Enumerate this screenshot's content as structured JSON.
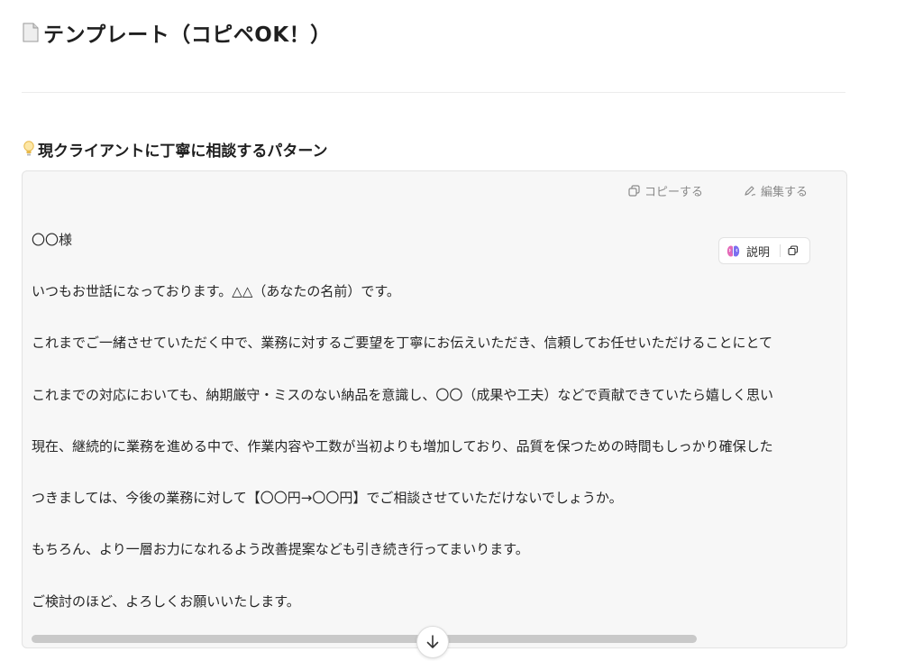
{
  "page": {
    "title": "テンプレート（コピペOK！）",
    "title_icon": "document-icon"
  },
  "section": {
    "heading": "現クライアントに丁寧に相談するパターン",
    "heading_icon": "lightbulb-icon"
  },
  "code_block": {
    "toolbar": {
      "copy_label": "コピーする",
      "edit_label": "編集する"
    },
    "explain": {
      "label": "説明",
      "icon": "brain-icon"
    },
    "lines": [
      "〇〇様",
      "いつもお世話になっております。△△（あなたの名前）です。",
      "これまでご一緒させていただく中で、業務に対するご要望を丁寧にお伝えいただき、信頼してお任せいただけることにとて",
      "これまでの対応においても、納期厳守・ミスのない納品を意識し、〇〇（成果や工夫）などで貢献できていたら嬉しく思い",
      "現在、継続的に業務を進める中で、作業内容や工数が当初よりも増加しており、品質を保つための時間もしっかり確保した",
      "つきましては、今後の業務に対して【〇〇円→〇〇円】でご相談させていただけないでしょうか。",
      "もちろん、より一層お力になれるよう改善提案なども引き続き行ってまいります。",
      "ご検討のほど、よろしくお願いいたします。"
    ]
  },
  "scroll_down_icon": "arrow-down-icon",
  "colors": {
    "block_background": "#f7f7f7",
    "toolbar_text": "#8a8a8a",
    "body_text": "#262626"
  }
}
